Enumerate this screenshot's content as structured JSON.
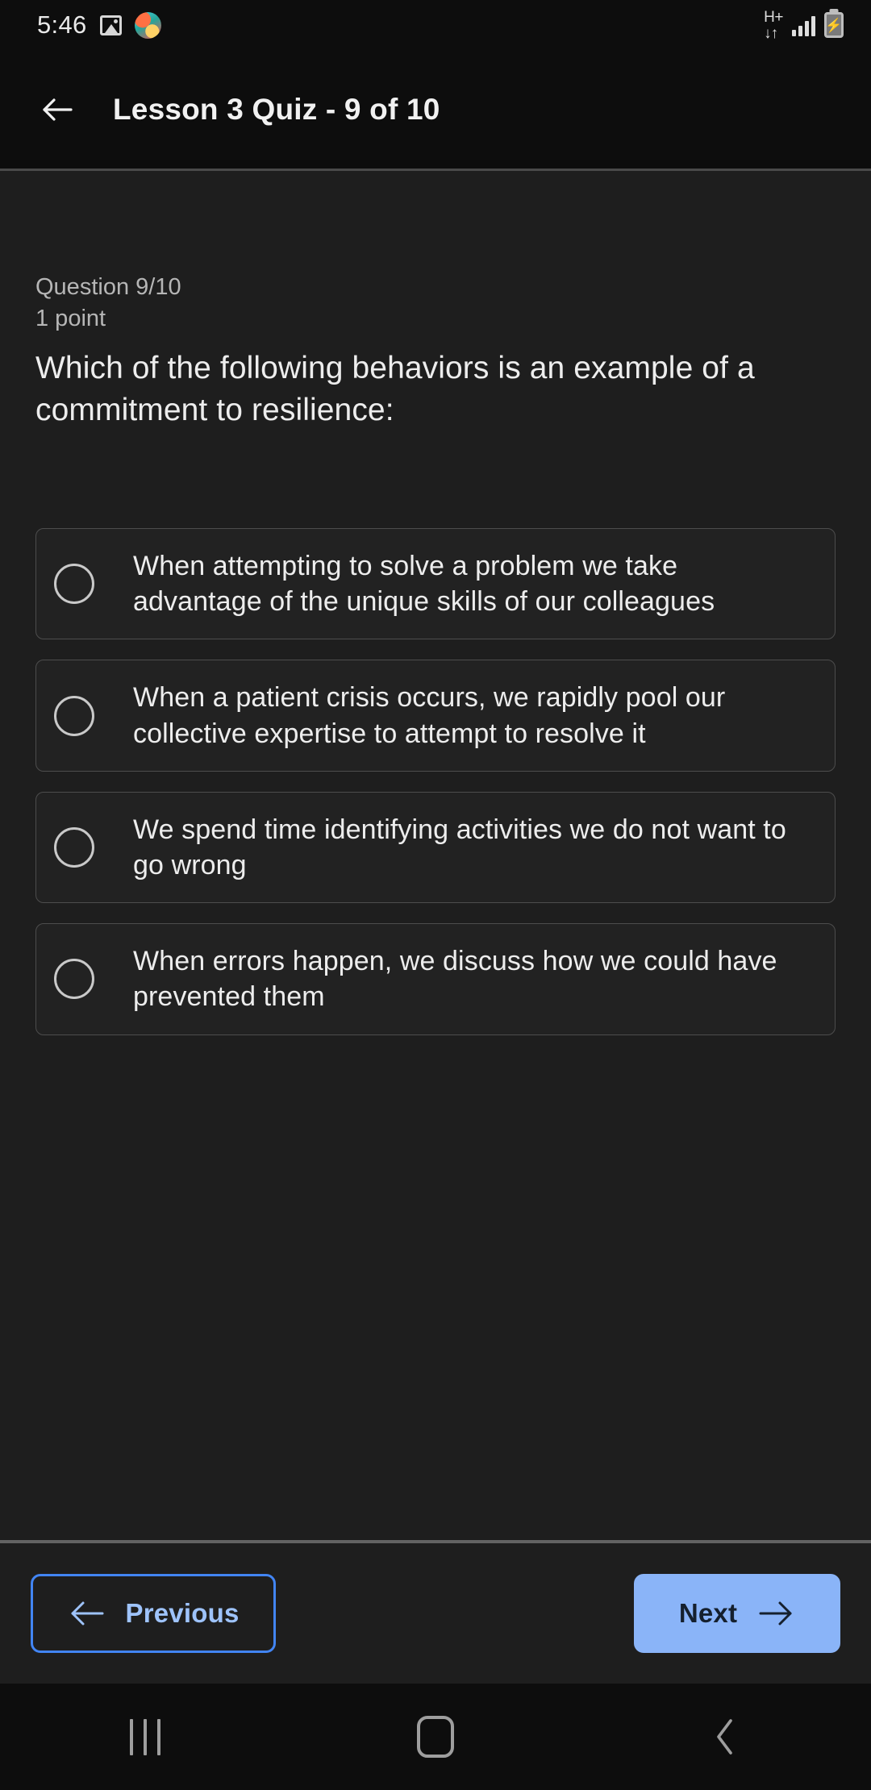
{
  "status_bar": {
    "time": "5:46",
    "icons_left": [
      "gallery-icon",
      "app-avatar-icon"
    ],
    "network_type": "H+",
    "network_arrows": "↓↑",
    "icons_right": [
      "signal-bars-icon",
      "battery-charging-icon"
    ],
    "battery_glyph": "⚡"
  },
  "header": {
    "back_icon": "arrow-left-icon",
    "title": "Lesson 3 Quiz - 9 of 10"
  },
  "question": {
    "counter": "Question 9/10",
    "points": "1 point",
    "text": "Which of the following behaviors is an example of a commitment to resilience:"
  },
  "options": [
    {
      "id": "option-1",
      "label": "When attempting to solve a problem we take advantage of the unique skills of our colleagues",
      "selected": false
    },
    {
      "id": "option-2",
      "label": "When a patient crisis occurs, we rapidly pool our collective expertise to attempt to resolve it",
      "selected": false
    },
    {
      "id": "option-3",
      "label": "We spend time identifying activities we do not want to go wrong",
      "selected": false
    },
    {
      "id": "option-4",
      "label": "When errors happen, we discuss how we could have prevented them",
      "selected": false
    }
  ],
  "footer": {
    "previous_label": "Previous",
    "previous_icon": "arrow-left-icon",
    "next_label": "Next",
    "next_icon": "arrow-right-icon"
  },
  "navbar": {
    "recents": "recents-icon",
    "home": "home-icon",
    "back": "back-chevron-icon"
  },
  "colors": {
    "page_background": "#1e1e1e",
    "chrome_background": "#0d0d0d",
    "card_background": "#222222",
    "card_border": "#4d4d4d",
    "accent_outline": "#4285f4",
    "accent_fill": "#8ab4f8",
    "accent_text_on_fill": "#15202e",
    "primary_text": "#ededed",
    "muted_text": "#b6b6b6"
  }
}
